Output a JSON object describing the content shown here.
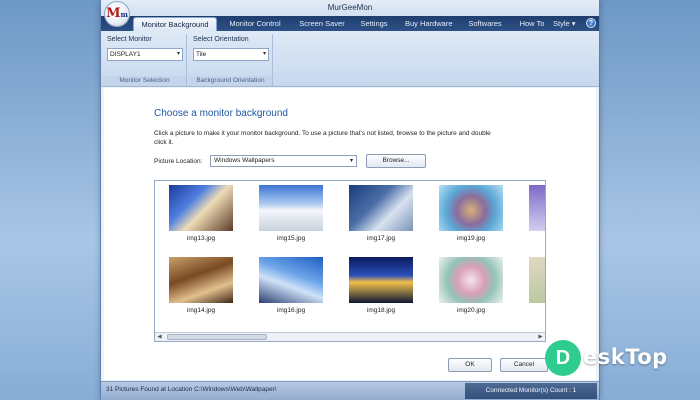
{
  "window": {
    "title": "MurGeeMon"
  },
  "logo": {
    "letter_main": "M",
    "letter_sub": "m"
  },
  "ribbon": {
    "tabs": [
      "Monitor Background",
      "Monitor Control",
      "Screen Saver",
      "Settings",
      "Buy Hardware",
      "Softwares",
      "How To"
    ],
    "style_label": "Style",
    "groups": [
      {
        "title": "Select Monitor",
        "value": "DISPLAY1",
        "footer": "Monitor Selection"
      },
      {
        "title": "Select Orientation",
        "value": "Tile",
        "footer": "Background Orientation"
      }
    ]
  },
  "main": {
    "heading": "Choose a monitor background",
    "description": "Click a picture to make it your monitor background. To use a picture that's not listed, browse to the picture and double click it.",
    "location_label": "Picture Location:",
    "location_value": "Windows Wallpapers",
    "browse_label": "Browse...",
    "thumbnails": [
      "img13.jpg",
      "img15.jpg",
      "img17.jpg",
      "img19.jpg",
      "img14.jpg",
      "img16.jpg",
      "img18.jpg",
      "img20.jpg"
    ],
    "ok_label": "OK",
    "cancel_label": "Cancel"
  },
  "status": {
    "left": "31 Pictures Found at Location C:\\Windows\\Web\\Wallpaper\\",
    "right": "Connected Monitor(s) Count : 1"
  },
  "watermark": {
    "text": "eskTop"
  },
  "colors": {
    "tab_bar": "#2d5186",
    "heading": "#1f56a3",
    "status_bar": "#93acd0"
  }
}
